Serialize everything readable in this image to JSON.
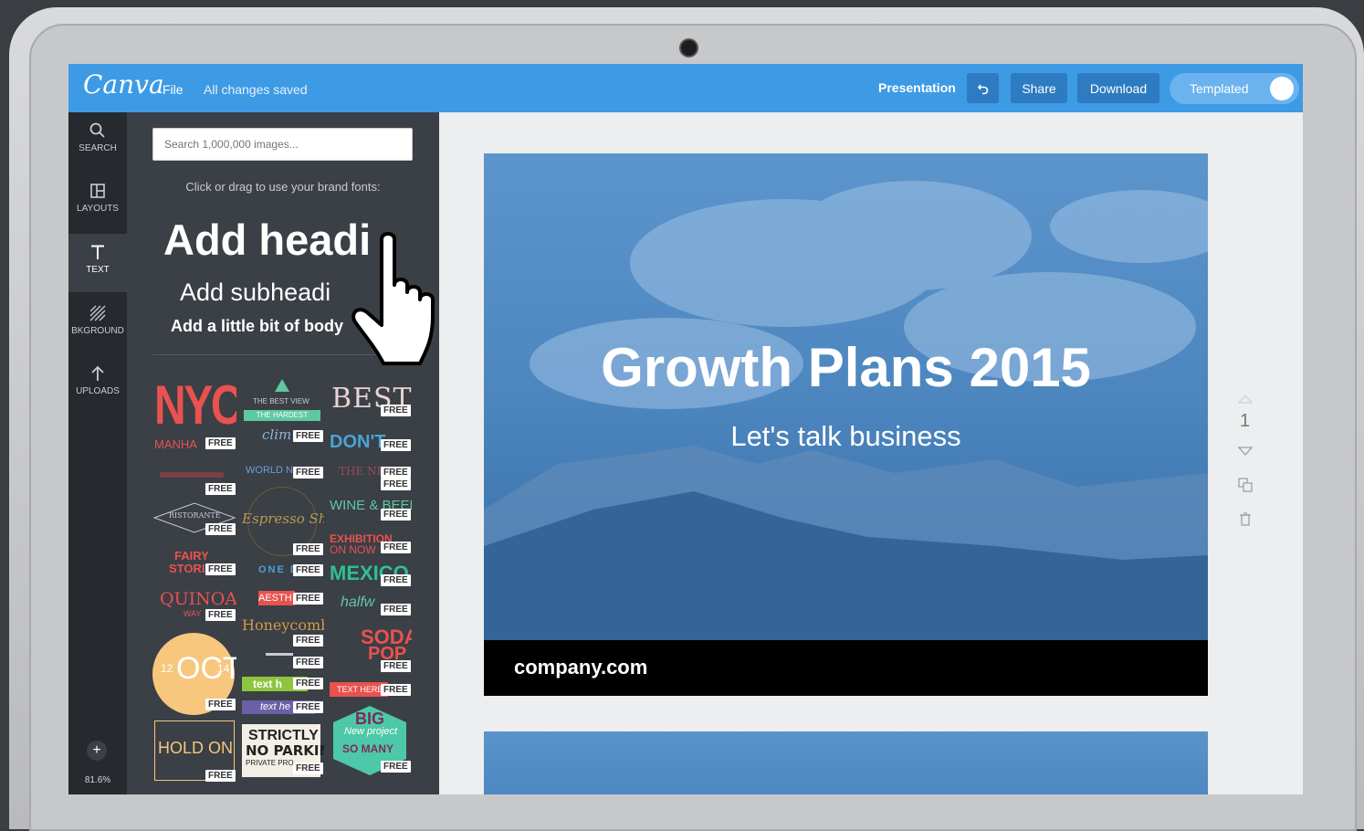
{
  "app": {
    "logo": "Canva"
  },
  "topbar": {
    "file": "File",
    "status": "All changes saved",
    "mode": "Presentation",
    "undo_icon": "undo-icon",
    "share": "Share",
    "download": "Download",
    "templated": "Templated",
    "templated_on": true,
    "color": "#3d9ae5"
  },
  "rail": {
    "items": [
      {
        "label": "SEARCH",
        "icon": "search-icon"
      },
      {
        "label": "LAYOUTS",
        "icon": "layouts-icon"
      },
      {
        "label": "TEXT",
        "icon": "text-icon"
      },
      {
        "label": "BKGROUND",
        "icon": "background-icon"
      },
      {
        "label": "UPLOADS",
        "icon": "upload-icon"
      }
    ],
    "zoom": "81.6%"
  },
  "panel": {
    "search_placeholder": "Search 1,000,000 images...",
    "hint": "Click or drag to use your brand fonts:",
    "add_heading": "Add headi",
    "add_subheading": "Add subheadi",
    "add_body": "Add a little bit of body",
    "free_label": "FREE",
    "tiles": [
      {
        "text": "NYC",
        "sub": "MANHA"
      },
      {
        "text": "THE BEST VIEW",
        "sub": "THE HARDEST"
      },
      {
        "text": "BEST"
      },
      {
        "text": "clim"
      },
      {
        "text": "DON'T"
      },
      {
        "text": "WORLD N"
      },
      {
        "text": "THE NEW"
      },
      {
        "text": "RISTORANTE"
      },
      {
        "text": "Espresso Shot"
      },
      {
        "text": "WINE & BEER"
      },
      {
        "text": "FAIRY",
        "sub": "STORI"
      },
      {
        "text": "EXHIBITION",
        "sub": "ON NOW"
      },
      {
        "text": "ONE D"
      },
      {
        "text": "MEXICO"
      },
      {
        "text": "QUINOA",
        "sub": "WAY"
      },
      {
        "text": "AESTH"
      },
      {
        "text": "halfw"
      },
      {
        "text": "Honeycomb"
      },
      {
        "text": "SODA",
        "sub": "POP"
      },
      {
        "text": "OCT",
        "sub": "12",
        "sub2": "14"
      },
      {
        "text": "text h"
      },
      {
        "text": "TEXT HERE"
      },
      {
        "text": "text he"
      },
      {
        "text": "HOLD ON"
      },
      {
        "text": "STRICTLY",
        "sub": "NO PARKING",
        "sub2": "PRIVATE PRO"
      },
      {
        "text": "BIG",
        "sub": "New project",
        "sub2": "SO MANY"
      }
    ]
  },
  "slide": {
    "title": "Growth Plans 2015",
    "subtitle": "Let's talk business",
    "footer": "company.com"
  },
  "page": {
    "number": "1"
  }
}
